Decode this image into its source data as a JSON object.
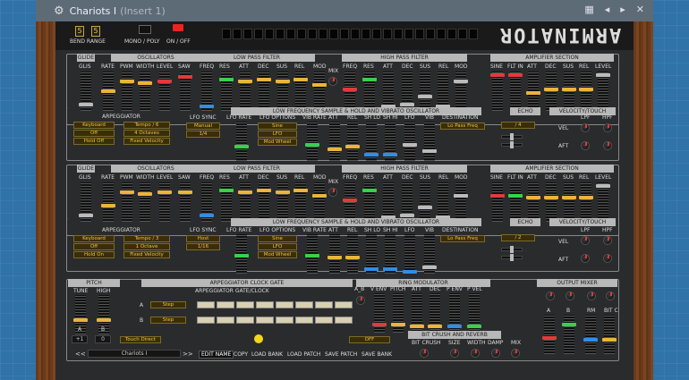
{
  "titlebar": {
    "title": "Chariots I",
    "insert": "(Insert 1)"
  },
  "header": {
    "bend_digit1": "5",
    "bend_digit2": "5",
    "bend_range": "BEND RANGE",
    "mono_poly": "MONO / POLY",
    "on_off": "ON / OFF",
    "logo": "ARMINATOR"
  },
  "colors": {
    "yellow": "#e9b53a",
    "red": "#e23a3a",
    "green": "#3ad04a",
    "blue": "#2e8ee8",
    "silver": "#bbbbbb"
  },
  "sections": {
    "glide": "GLIDE",
    "oscillators": "OSCILLATORS",
    "lpf": "LOW PASS FILTER",
    "hpf": "HIGH PASS FILTER",
    "amp": "AMPLIFIER SECTION",
    "lfo": "LOW FREQUENCY  SAMPLE & HOLD  AND  VIBRATO  OSCILLATOR",
    "echo": "ECHO",
    "velocity": "VELOCITY/TOUCH",
    "pitch": "PITCH",
    "clock": "ARPEGGIATOR CLOCK GATE",
    "ring": "RING MODULATOR",
    "output": "OUTPUT MIXER",
    "bitcrush": "BIT CRUSH AND REVERB"
  },
  "labels": {
    "glis": "GLIS",
    "rate": "RATE",
    "pwm": "PWM",
    "width": "WIDTH",
    "level": "LEVEL",
    "saw": "SAW",
    "freq": "FREQ",
    "res": "RES",
    "att": "ATT",
    "dec": "DEC",
    "sus": "SUS",
    "rel": "REL",
    "mod": "MOD",
    "mix": "MIX",
    "sine": "SINE",
    "fltin": "FLT IN",
    "aft": "AFT",
    "vel": "VEL",
    "lpf": "LPF",
    "hpf": "HPF",
    "arpeggiator": "ARPEGGIATOR",
    "lfo_sync": "LFO SYNC",
    "lfo_rate": "LFO RATE",
    "lfo_options": "LFO OPTIONS",
    "vib_rate": "VIB RATE",
    "shlo": "SH LO",
    "shhi": "SH HI",
    "lfo": "LFO",
    "vib": "VIB",
    "destination": "DESTINATION",
    "tune": "TUNE",
    "high": "HIGH",
    "a": "A",
    "b": "B",
    "gate": "ARPEGGIATOR GATE/CLOCK",
    "ab": "A_B",
    "venv": "V ENV",
    "pitch_l": "PITCH",
    "penv": "P ENV",
    "pvel": "P VEL",
    "rm": "RM",
    "bitc": "BIT C",
    "bitcrush_l": "BIT CRUSH",
    "size": "SIZE",
    "damp": "DAMP"
  },
  "voice1": {
    "arp": [
      "Keyboard",
      "Off",
      "Hold Off"
    ],
    "arp2": [
      "Tempo / 6",
      "4 Octaves",
      "Fixed Velocity"
    ],
    "lfo_sync": [
      "Manual",
      "1/4"
    ],
    "lfo_opts": [
      "Sine",
      "LFO",
      "Mod Wheel"
    ],
    "destination": "Lo Pass Freq",
    "echo_val": "/ 4"
  },
  "voice2": {
    "arp": [
      "Keyboard",
      "Off",
      "Hold On"
    ],
    "arp2": [
      "Tempo / 3",
      "1 Octave",
      "Fixed Velocity"
    ],
    "lfo_sync": [
      "Host",
      "1/16"
    ],
    "lfo_opts": [
      "Sine",
      "LFO",
      "Mod Wheel"
    ],
    "destination": "Lo Pass Freq",
    "echo_val": "/ 2"
  },
  "bottom": {
    "tune_val": "+1",
    "high_val": "0",
    "touch": "Touch Direct",
    "step_a": "Step",
    "step_b": "Step",
    "off": "OFF",
    "patch_name": "Chariots I",
    "prev": "<<",
    "next": ">>",
    "edit_name": "EDIT NAME",
    "copy": "COPY",
    "load_bank": "LOAD BANK",
    "load_patch": "LOAD PATCH",
    "save_patch": "SAVE PATCH",
    "save_bank": "SAVE BANK"
  }
}
